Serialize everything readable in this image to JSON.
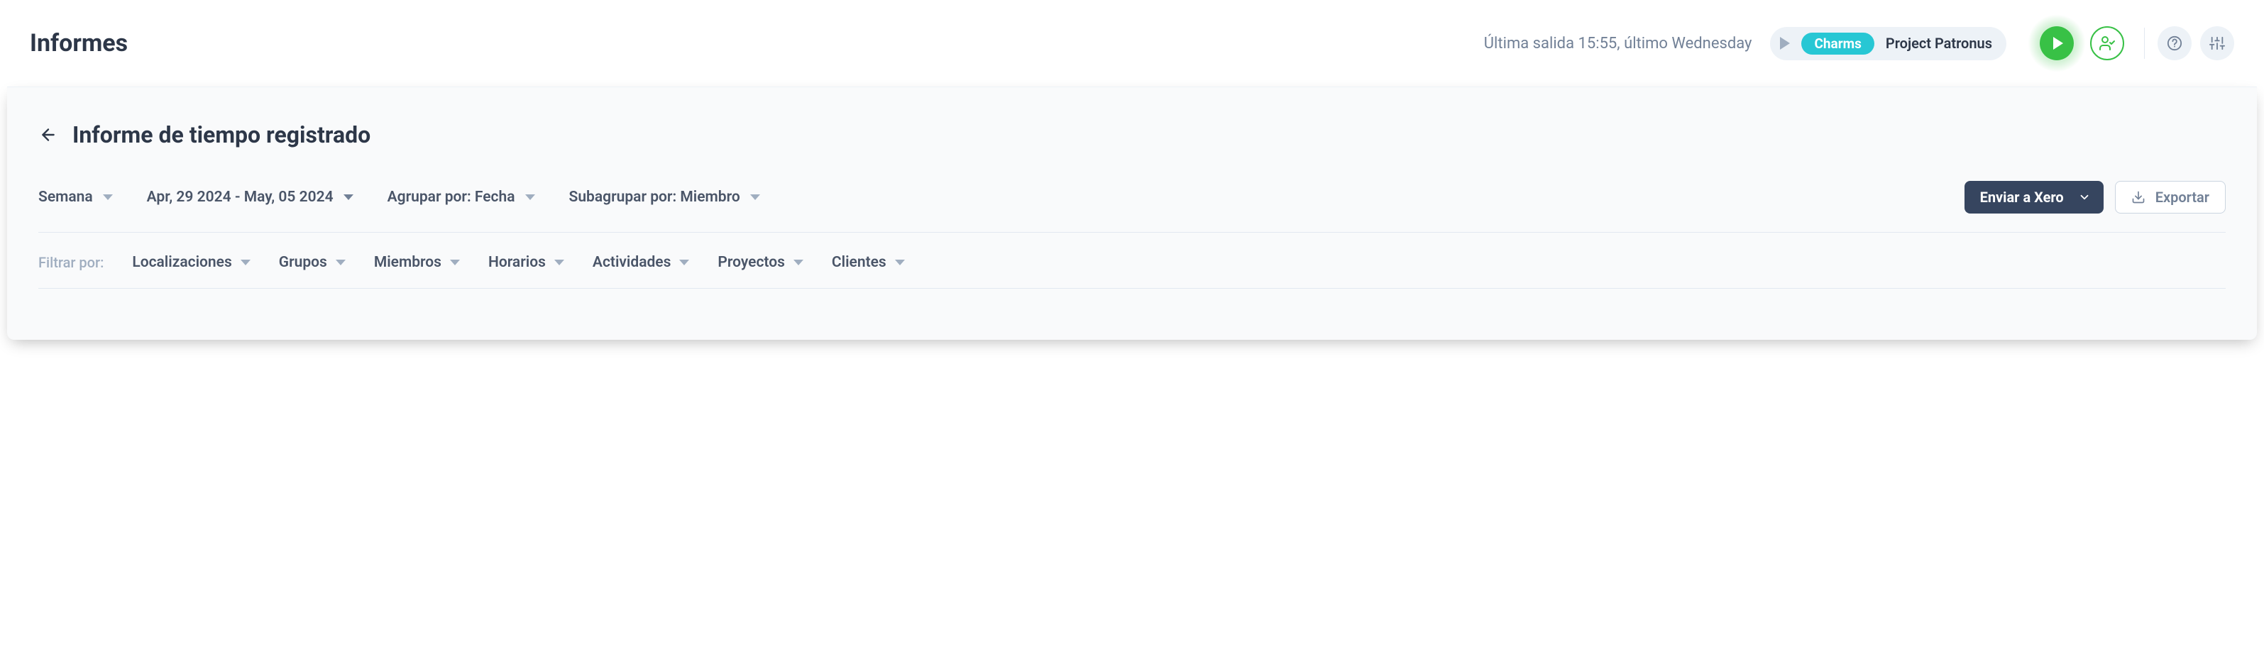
{
  "header": {
    "app_title": "Informes",
    "status_text": "Última salida 15:55, último Wednesday",
    "chip_label": "Charms",
    "project_name": "Project Patronus"
  },
  "page": {
    "title": "Informe de tiempo registrado"
  },
  "toolbar": {
    "period_label": "Semana",
    "date_range": "Apr, 29 2024 - May, 05 2024",
    "group_by": "Agrupar por: Fecha",
    "subgroup_by": "Subagrupar por: Miembro",
    "send_to_xero": "Enviar a Xero",
    "export": "Exportar"
  },
  "filters": {
    "label": "Filtrar por:",
    "items": [
      "Localizaciones",
      "Grupos",
      "Miembros",
      "Horarios",
      "Actividades",
      "Proyectos",
      "Clientes"
    ]
  }
}
